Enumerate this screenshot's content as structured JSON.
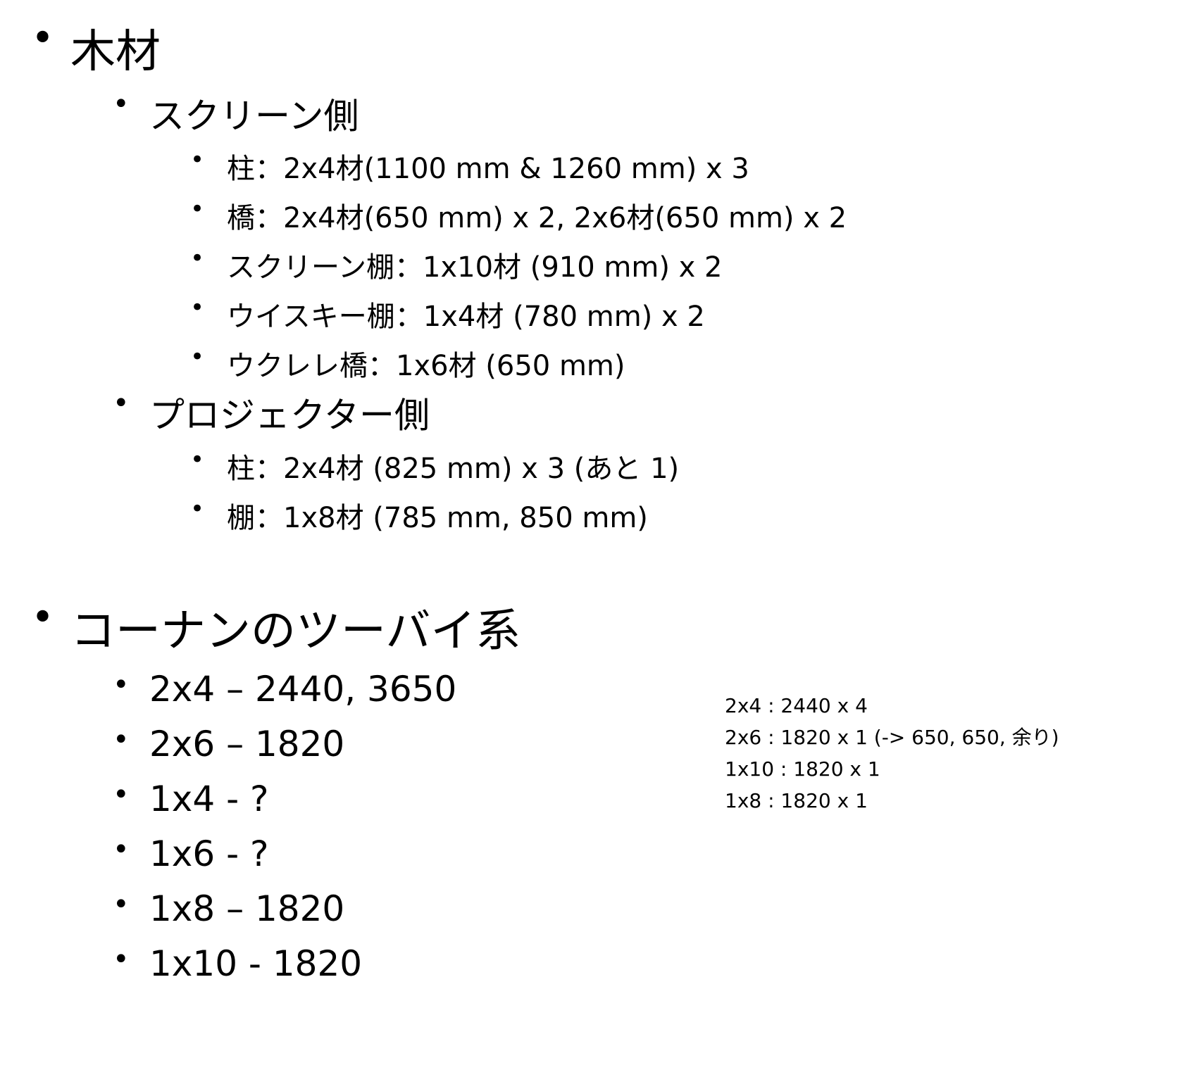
{
  "sections": [
    {
      "title": "木材",
      "groups": [
        {
          "title": "スクリーン側",
          "items": [
            "柱：2x4材(1100 mm & 1260 mm)  x  3",
            "橋：2x4材(650 mm) x 2,  2x6材(650 mm) x 2",
            "スクリーン棚：1x10材 (910 mm) x 2",
            "ウイスキー棚：1x4材 (780 mm) x 2",
            "ウクレレ橋：1x6材 (650 mm)"
          ]
        },
        {
          "title": "プロジェクター側",
          "items": [
            "柱：2x4材 (825 mm) x 3 (あと 1)",
            "棚：1x8材 (785 mm, 850 mm)"
          ]
        }
      ]
    },
    {
      "title": "コーナンのツーバイ系",
      "items": [
        "2x4 – 2440, 3650",
        "2x6 – 1820",
        "1x4 - ?",
        "1x6 - ?",
        "1x8 – 1820",
        "1x10 - 1820"
      ]
    }
  ],
  "notes": [
    "2x4 : 2440 x 4",
    "2x6 : 1820 x 1 (-> 650, 650, 余り)",
    "1x10 : 1820 x 1",
    "1x8 : 1820 x 1"
  ],
  "bullet_symbol": "•"
}
